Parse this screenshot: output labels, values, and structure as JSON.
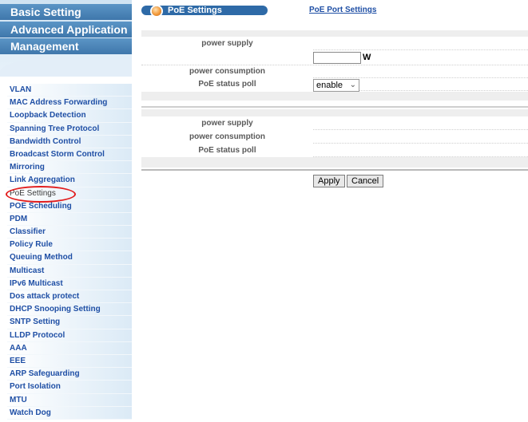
{
  "topnav": {
    "tabs": [
      "Basic Setting",
      "Advanced Application",
      "Management"
    ]
  },
  "sidebar": {
    "items": [
      "VLAN",
      "MAC Address Forwarding",
      "Loopback Detection",
      "Spanning Tree Protocol",
      "Bandwidth Control",
      "Broadcast Storm Control",
      "Mirroring",
      "Link Aggregation",
      "PoE Settings",
      "POE Scheduling",
      "PDM",
      "Classifier",
      "Policy Rule",
      "Queuing Method",
      "Multicast",
      "IPv6 Multicast",
      "Dos attack protect",
      "DHCP Snooping Setting",
      "SNTP Setting",
      "LLDP Protocol",
      "AAA",
      "EEE",
      "ARP Safeguarding",
      "Port Isolation",
      "MTU",
      "Watch Dog"
    ],
    "active": "PoE Settings"
  },
  "header": {
    "title": "PoE Settings",
    "port_link": "PoE Port Settings"
  },
  "config": {
    "power_supply_label": "power supply",
    "power_supply_value": "",
    "unit": "W",
    "power_consumption_label": "power consumption",
    "status_poll_label": "PoE status poll",
    "status_poll_value": "enable"
  },
  "status": {
    "power_supply_label": "power supply",
    "power_consumption_label": "power consumption",
    "status_poll_label": "PoE status poll"
  },
  "buttons": {
    "apply": "Apply",
    "cancel": "Cancel"
  },
  "colors": {
    "nav_blue": "#3f77ab",
    "link_blue": "#1f4fa5",
    "highlight_red": "#e21c1c"
  }
}
